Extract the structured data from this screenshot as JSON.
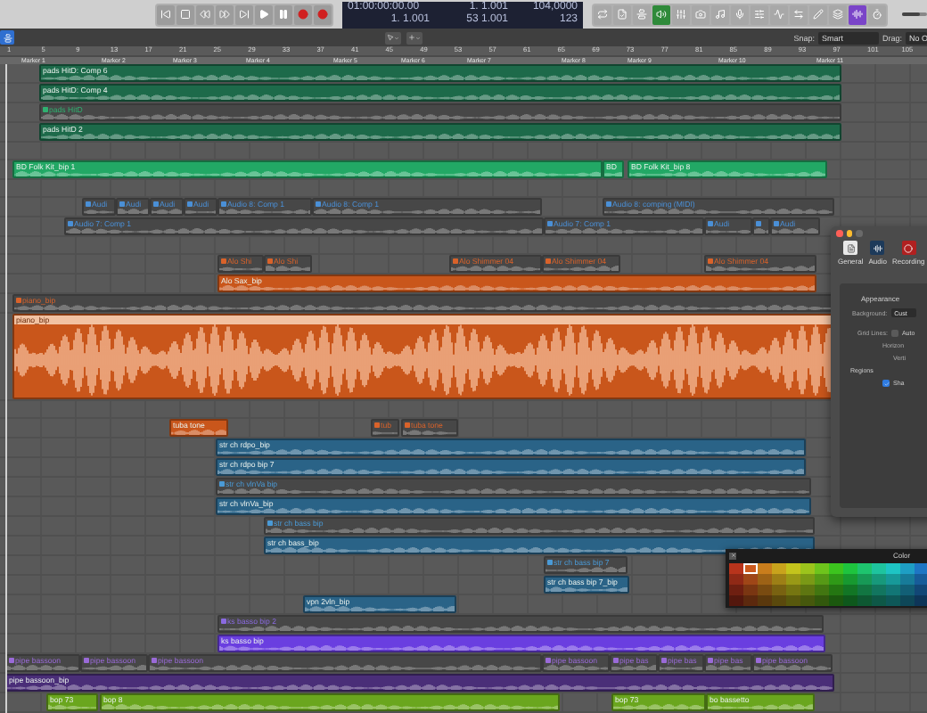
{
  "transport": {
    "buttons": [
      {
        "kind": "start"
      },
      {
        "kind": "stop"
      },
      {
        "kind": "rewind"
      },
      {
        "kind": "forward"
      },
      {
        "kind": "end"
      },
      {
        "kind": "play"
      },
      {
        "kind": "pause"
      },
      {
        "kind": "record"
      },
      {
        "kind": "record"
      }
    ]
  },
  "lcd": {
    "timecode": "01:00:00:00.00",
    "position": "1. 1.001",
    "locator_start": "1. 1.001",
    "locator_end": "53 1.001",
    "tempo": "104,0000",
    "tempo_sub": "123"
  },
  "tool_buttons": [
    {
      "kind": "toggle",
      "on": false
    },
    {
      "kind": "toggle",
      "on": false
    },
    {
      "kind": "toggle",
      "on": false
    },
    {
      "kind": "toggle",
      "on": true
    },
    {
      "kind": "toggle",
      "on": false
    },
    {
      "kind": "toggle",
      "on": false
    },
    {
      "kind": "toggle",
      "on": false
    },
    {
      "kind": "toggle",
      "on": false
    },
    {
      "kind": "toggle",
      "on": false
    },
    {
      "kind": "toggle",
      "on": false
    },
    {
      "kind": "toggle",
      "on": false
    },
    {
      "kind": "toggle",
      "on": false
    },
    {
      "kind": "toggle",
      "on": false
    },
    {
      "kind": "mode",
      "on": true
    },
    {
      "kind": "toggle",
      "on": false
    }
  ],
  "master_volume": {
    "level": 0.7
  },
  "arrange_bar": {
    "snap_label": "Snap:",
    "snap_value": "Smart",
    "drag_label": "Drag:",
    "drag_value": "No O"
  },
  "ruler": [
    "1",
    "5",
    "9",
    "13",
    "17",
    "21",
    "25",
    "29",
    "33",
    "37",
    "41",
    "45",
    "49",
    "53",
    "57",
    "61",
    "65",
    "69",
    "73",
    "77",
    "81",
    "85",
    "89",
    "93",
    "97",
    "101",
    "105"
  ],
  "markers": [
    "Marker 1",
    "Marker 2",
    "Marker 3",
    "Marker 4",
    "Marker 5",
    "Marker 6",
    "Marker 7",
    "Marker 8",
    "Marker 9",
    "Marker 10",
    "Marker 11"
  ],
  "lanes": [
    {
      "kind": "normal",
      "regions": [
        {
          "name": "pads HitD: Comp 6",
          "kind": "solid",
          "color": "#1d6a4a"
        }
      ]
    },
    {
      "kind": "normal",
      "regions": [
        {
          "name": "pads HitD: Comp 4",
          "kind": "solid",
          "color": "#1d6a4a"
        }
      ]
    },
    {
      "kind": "normal",
      "regions": [
        {
          "name": "pads HitD",
          "kind": "take",
          "color": "#2fb070"
        }
      ]
    },
    {
      "kind": "normal",
      "regions": [
        {
          "name": "pads HitD 2",
          "kind": "solid",
          "color": "#1d6a4a"
        }
      ]
    },
    {
      "kind": "gap"
    },
    {
      "kind": "normal",
      "regions": [
        {
          "name": "BD Folk Kit_bip 1",
          "kind": "solid",
          "color": "#22a865"
        },
        {
          "name": "BD",
          "kind": "solid",
          "color": "#22a865"
        },
        {
          "name": "BD Folk Kit_bip 8",
          "kind": "solid",
          "color": "#22a865"
        }
      ]
    },
    {
      "kind": "gap"
    },
    {
      "kind": "normal",
      "regions": [
        {
          "name": "Audi",
          "kind": "take",
          "color": "#4a8fd6"
        },
        {
          "name": "Audi",
          "kind": "take",
          "color": "#4a8fd6"
        },
        {
          "name": "Audi",
          "kind": "take",
          "color": "#4a8fd6"
        },
        {
          "name": "Audi",
          "kind": "take",
          "color": "#4a8fd6"
        },
        {
          "name": "Audio 8: Comp 1",
          "kind": "take",
          "color": "#4a8fd6"
        },
        {
          "name": "Audio 8: Comp 1",
          "kind": "take",
          "color": "#4a8fd6"
        },
        {
          "name": "Audio 8: comping (MIDI)",
          "kind": "take",
          "color": "#4a8fd6"
        }
      ]
    },
    {
      "kind": "normal",
      "regions": [
        {
          "name": "Audio 7: Comp 1",
          "kind": "take",
          "color": "#4a8fd6"
        },
        {
          "name": "Audio 7: Comp 1",
          "kind": "take",
          "color": "#4a8fd6"
        },
        {
          "name": "Audi",
          "kind": "take",
          "color": "#4a8fd6"
        },
        {
          "kind": "take",
          "color": "#4a8fd6"
        },
        {
          "name": "Audi",
          "kind": "take",
          "color": "#4a8fd6"
        }
      ]
    },
    {
      "kind": "gap"
    },
    {
      "kind": "normal",
      "regions": [
        {
          "name": "Alo Shi",
          "kind": "take",
          "color": "#d9622a"
        },
        {
          "name": "Alo Shi",
          "kind": "take",
          "color": "#d9622a"
        },
        {
          "name": "Alo Shimmer 04",
          "kind": "take",
          "color": "#d9622a"
        },
        {
          "name": "Alo Shimmer 04",
          "kind": "take",
          "color": "#d9622a"
        },
        {
          "name": "Alo Shimmer 04",
          "kind": "take",
          "color": "#d9622a"
        }
      ]
    },
    {
      "kind": "normal",
      "regions": [
        {
          "name": "Alo Sax_bip",
          "kind": "solid",
          "color": "#c9561b"
        }
      ]
    },
    {
      "kind": "normal",
      "regions": [
        {
          "name": "piano_bip",
          "kind": "take",
          "color": "#d9622a"
        }
      ]
    },
    {
      "kind": "tall",
      "regions": [
        {
          "name": "piano_bip",
          "kind": "solid",
          "color": "#c9561b"
        }
      ]
    },
    {
      "kind": "gap"
    },
    {
      "kind": "normal",
      "regions": [
        {
          "name": "tuba tone",
          "kind": "solid",
          "color": "#c9561b"
        },
        {
          "name": "tub",
          "kind": "take",
          "color": "#d9622a"
        },
        {
          "name": "tuba tone",
          "kind": "take",
          "color": "#d9622a"
        }
      ]
    },
    {
      "kind": "normal",
      "regions": [
        {
          "name": "str ch rdpo_bip",
          "kind": "solid",
          "color": "#2a6387"
        }
      ]
    },
    {
      "kind": "normal",
      "regions": [
        {
          "name": "str ch rdpo bip 7",
          "kind": "solid",
          "color": "#2a6387"
        }
      ]
    },
    {
      "kind": "normal",
      "regions": [
        {
          "name": "str ch vlnVa bip",
          "kind": "take",
          "color": "#4a9ad6"
        }
      ]
    },
    {
      "kind": "normal",
      "regions": [
        {
          "name": "str ch vlnVa_bip",
          "kind": "solid",
          "color": "#2a6387"
        }
      ]
    },
    {
      "kind": "normal",
      "regions": [
        {
          "name": "str ch bass bip",
          "kind": "take",
          "color": "#4a9ad6"
        }
      ]
    },
    {
      "kind": "normal",
      "regions": [
        {
          "name": "str ch bass_bip",
          "kind": "solid",
          "color": "#2a6387"
        }
      ]
    },
    {
      "kind": "normal",
      "regions": [
        {
          "name": "str ch bass bip 7",
          "kind": "take",
          "color": "#4a9ad6"
        }
      ]
    },
    {
      "kind": "normal",
      "regions": [
        {
          "name": "str ch bass bip 7_bip",
          "kind": "solid",
          "color": "#2a6387"
        }
      ]
    },
    {
      "kind": "normal",
      "regions": [
        {
          "name": "vpn 2vln_bip",
          "kind": "solid",
          "color": "#2a6387"
        }
      ]
    },
    {
      "kind": "normal",
      "regions": [
        {
          "name": "ks basso bip 2",
          "kind": "take",
          "color": "#8a6ae0"
        }
      ]
    },
    {
      "kind": "normal",
      "regions": [
        {
          "name": "ks basso bip",
          "kind": "solid",
          "color": "#6a3ee0"
        }
      ]
    },
    {
      "kind": "normal",
      "regions": [
        {
          "name": "pipe bassoon",
          "kind": "take",
          "color": "#9a6ad8"
        },
        {
          "name": "pipe bassoon",
          "kind": "take",
          "color": "#9a6ad8"
        },
        {
          "name": "pipe bassoon",
          "kind": "take",
          "color": "#9a6ad8"
        },
        {
          "name": "pipe bassoon",
          "kind": "take",
          "color": "#9a6ad8"
        },
        {
          "name": "pipe bas",
          "kind": "take",
          "color": "#9a6ad8"
        },
        {
          "name": "pipe bas",
          "kind": "take",
          "color": "#9a6ad8"
        },
        {
          "name": "pipe bas",
          "kind": "take",
          "color": "#9a6ad8"
        },
        {
          "name": "pipe bassoon",
          "kind": "take",
          "color": "#9a6ad8"
        }
      ]
    },
    {
      "kind": "normal",
      "regions": [
        {
          "name": "pipe bassoon_bip",
          "kind": "solid",
          "color": "#4a2e78"
        }
      ]
    },
    {
      "kind": "normal",
      "regions": [
        {
          "name": "bop 73",
          "kind": "solid",
          "color": "#6aa61e"
        },
        {
          "name": "bop 8",
          "kind": "solid",
          "color": "#6aa61e"
        },
        {
          "name": "bop 73",
          "kind": "solid",
          "color": "#6aa61e"
        },
        {
          "name": "bo bassetto",
          "kind": "solid",
          "color": "#6aa61e"
        }
      ]
    }
  ],
  "settings_window": {
    "tabs": [
      {
        "label": "General",
        "selected": false
      },
      {
        "label": "Audio",
        "selected": false
      },
      {
        "label": "Recording",
        "selected": false
      }
    ],
    "section": "Appearance",
    "background_label": "Background:",
    "background_value": "Cust",
    "grid_label": "Grid Lines:",
    "grid_auto": {
      "label": "Auto",
      "checked": false
    },
    "horizontal_label": "Horizon",
    "vertical_label": "Verti",
    "regions_label": "Regions",
    "regions_option": {
      "label": "Sha",
      "checked": true
    }
  },
  "color_picker": {
    "title": "Color",
    "swatches": [
      {
        "color": "#b8341c",
        "selected": false
      },
      {
        "color": "#cc5a1e",
        "selected": true
      },
      {
        "color": "#c97d1c",
        "selected": false
      },
      {
        "color": "#c9a31c",
        "selected": false
      },
      {
        "color": "#c4c41c",
        "selected": false
      },
      {
        "color": "#9cc41c",
        "selected": false
      },
      {
        "color": "#6ec41c",
        "selected": false
      },
      {
        "color": "#3cc41e",
        "selected": false
      },
      {
        "color": "#1ec43e",
        "selected": false
      },
      {
        "color": "#1ec46e",
        "selected": false
      },
      {
        "color": "#1ec49e",
        "selected": false
      },
      {
        "color": "#1ec4c4",
        "selected": false
      },
      {
        "color": "#1e9ec4",
        "selected": false
      },
      {
        "color": "#1e76c4",
        "selected": false
      }
    ]
  }
}
